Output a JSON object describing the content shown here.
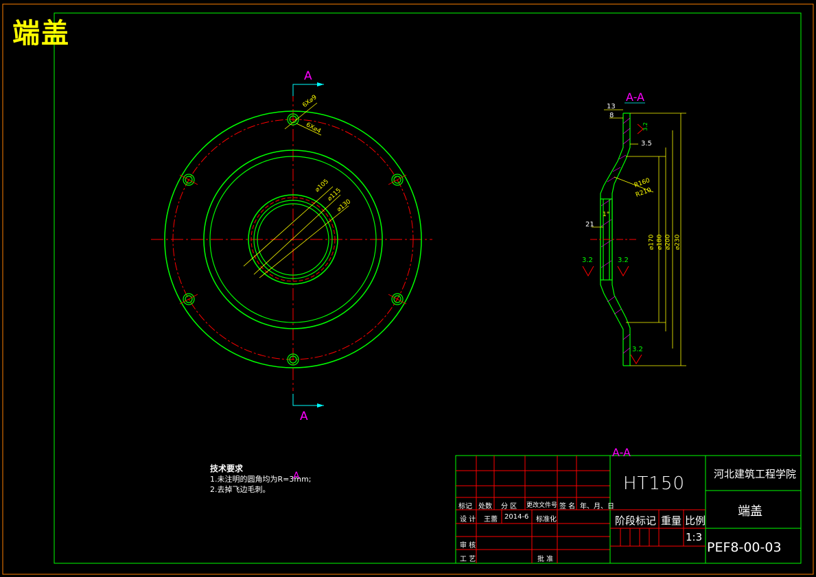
{
  "title": "端盖",
  "section": {
    "marker": "A",
    "view_label": "A-A",
    "stray_label": "A-A",
    "stray_marker": "A"
  },
  "front_view_dims": {
    "hole_top": "6X⌀9",
    "hole_bottom": "6X⌀4",
    "d105": "⌀105",
    "d115": "⌀115",
    "d130": "⌀130"
  },
  "section_view_dims": {
    "w13": "13",
    "w8": "8",
    "r32_top": "3.2",
    "w35": "3.5",
    "r160": "R160",
    "r210": "R210",
    "angle": "1°",
    "w21": "21",
    "rough_left": "3.2",
    "rough_mid": "3.2",
    "rough_bottom": "3.2",
    "d170": "⌀170",
    "d180": "⌀180",
    "d200": "⌀200",
    "d230": "⌀230"
  },
  "tech_requirements": {
    "heading": "技术要求",
    "line1": "1.未注明的圆角均为R=3mm;",
    "line2": "2.去掉飞边毛刺。"
  },
  "title_block": {
    "material": "HT150",
    "school": "河北建筑工程学院",
    "part_name": "端盖",
    "drawing_no": "PEF8-00-03",
    "stage_mark": "阶段标记",
    "weight": "重量",
    "scale_label": "比例",
    "scale": "1:3",
    "h_mark": "标记",
    "h_count": "处数",
    "h_zone": "分 区",
    "h_doc": "更改文件号",
    "h_sign": "签 名",
    "h_date": "年、月、日",
    "design": "设 计",
    "designer": "王蕾",
    "design_date": "2014-6",
    "standard": "标准化",
    "review": "审 核",
    "process": "工 艺",
    "approve": "批 准"
  },
  "colors": {
    "frame": "#ff8000",
    "green": "#00ff00",
    "red": "#ff0000",
    "yellow": "#ffff00",
    "magenta": "#ff00ff",
    "cyan": "#00ffff",
    "white": "#ffffff"
  }
}
